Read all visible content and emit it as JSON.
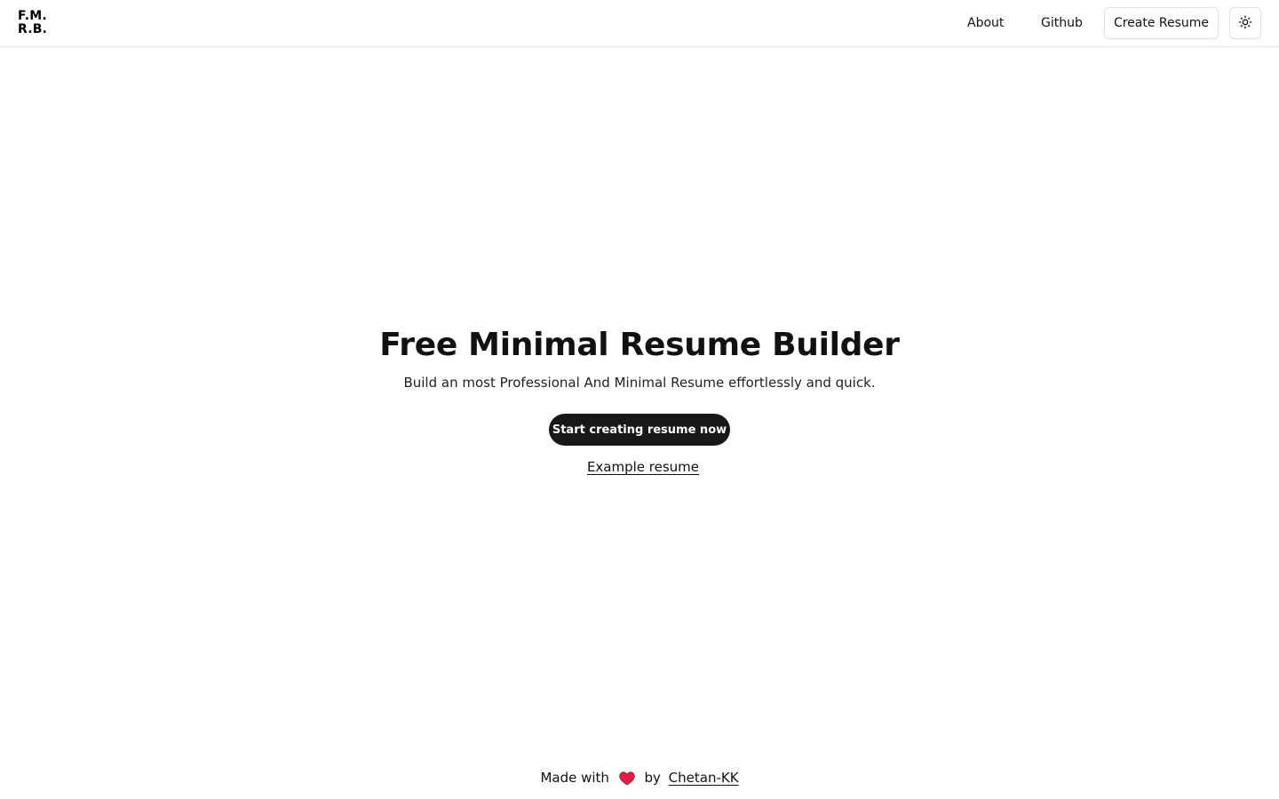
{
  "header": {
    "logo_line1": "F.M.",
    "logo_line2": "R.B.",
    "nav": {
      "about": "About",
      "github": "Github"
    },
    "create_button": "Create Resume",
    "theme_toggle_icon": "sun-icon"
  },
  "hero": {
    "title": "Free Minimal Resume Builder",
    "subtitle": "Build an most Professional And Minimal Resume effortlessly and quick.",
    "start_button": "Start creating resume now",
    "example_link": "Example resume"
  },
  "footer": {
    "made_with": "Made with",
    "heart_icon": "heart-icon",
    "by": "by",
    "author": "Chetan-KK"
  },
  "colors": {
    "primary_button": "#18181b",
    "border": "#e5e5e5",
    "heart": "#e11d48"
  }
}
